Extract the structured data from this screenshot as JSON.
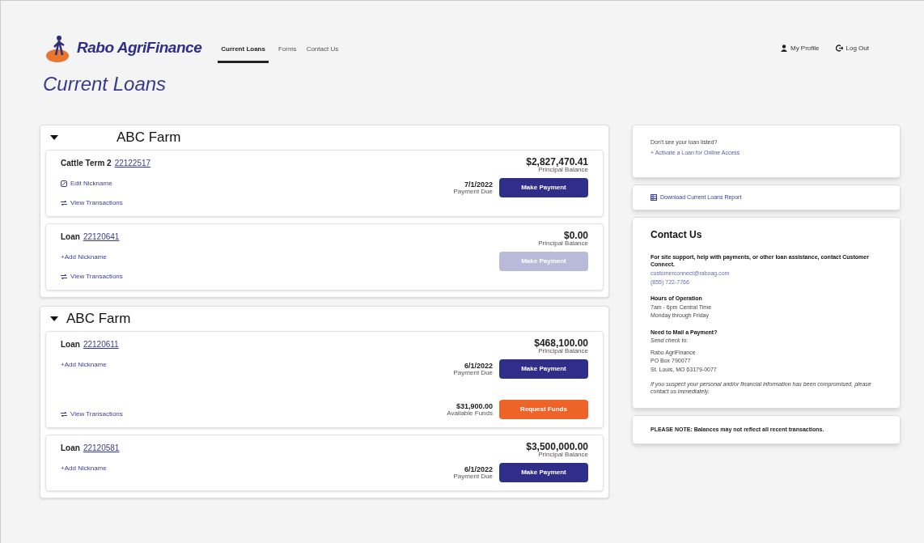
{
  "header": {
    "logo_text": "Rabo AgriFinance",
    "nav": [
      {
        "label": "Current Loans",
        "selected": true
      },
      {
        "label": "Forms",
        "selected": false
      },
      {
        "label": "Contact Us",
        "selected": false
      }
    ],
    "user_links": [
      {
        "kind": "profile",
        "label": "My Profile"
      },
      {
        "kind": "logout",
        "label": "Log Out"
      }
    ]
  },
  "page_title": "Current Loans",
  "groups": [
    {
      "name": "ABC Farm",
      "expanded": true,
      "loans": [
        {
          "name": "Cattle Term 2",
          "number": "22122517",
          "nickname_link": {
            "kind": "edit",
            "label": "Edit Nickname"
          },
          "view_transactions": "View Transactions",
          "balance": "$2,827,470.41",
          "balance_label": "Principal Balance",
          "due_date": "7/1/2022",
          "due_label": "Payment Due",
          "payment_button": {
            "label": "Make Payment",
            "disabled": false
          }
        },
        {
          "name": "Loan",
          "number": "22120641",
          "nickname_link": {
            "kind": "add",
            "label": "+Add Nickname"
          },
          "view_transactions": "View Transactions",
          "balance": "$0.00",
          "balance_label": "Principal Balance",
          "payment_button": {
            "label": "Make Payment",
            "disabled": true
          }
        }
      ]
    },
    {
      "name": "ABC Farm",
      "expanded": true,
      "loans": [
        {
          "name": "Loan",
          "number": "22120611",
          "nickname_link": {
            "kind": "add",
            "label": "+Add Nickname"
          },
          "view_transactions": "View Transactions",
          "balance": "$468,100.00",
          "balance_label": "Principal Balance",
          "due_date": "6/1/2022",
          "due_label": "Payment Due",
          "payment_button": {
            "label": "Make Payment",
            "disabled": false
          },
          "funds": {
            "amount": "$31,900.00",
            "label": "Available Funds",
            "button": "Request Funds"
          }
        },
        {
          "name": "Loan",
          "number": "22120581",
          "nickname_link": {
            "kind": "add",
            "label": "+Add Nickname"
          },
          "balance": "$3,500,000.00",
          "balance_label": "Principal Balance",
          "due_date": "6/1/2022",
          "due_label": "Payment Due",
          "payment_button": {
            "label": "Make Payment",
            "disabled": false
          }
        }
      ]
    }
  ],
  "sidebar": {
    "activate": {
      "question": "Don't see your loan listed?",
      "link": "+ Activate a Loan for Online Access"
    },
    "report_link": "Download Current Loans Report",
    "contact": {
      "title": "Contact Us",
      "intro": "For site support, help with payments, or other loan assistance, contact Customer Connect.",
      "email": "customerconnect@raboag.com",
      "phone": "(855) 722-7766",
      "hours_title": "Hours of Operation",
      "hours": [
        "7am - 6pm Central Time",
        "Monday through Friday"
      ],
      "mail_title": "Need to Mail a Payment?",
      "mail_intro": "Send check to:",
      "address": [
        "Rabo AgriFinance",
        "PO Box 790077",
        "St. Louis, MO 63179-0077"
      ],
      "warning": "If you suspect your personal and/or financial information has been compromised, please contact us immediately."
    },
    "note": "PLEASE NOTE: Balances may not reflect all recent transactions."
  }
}
